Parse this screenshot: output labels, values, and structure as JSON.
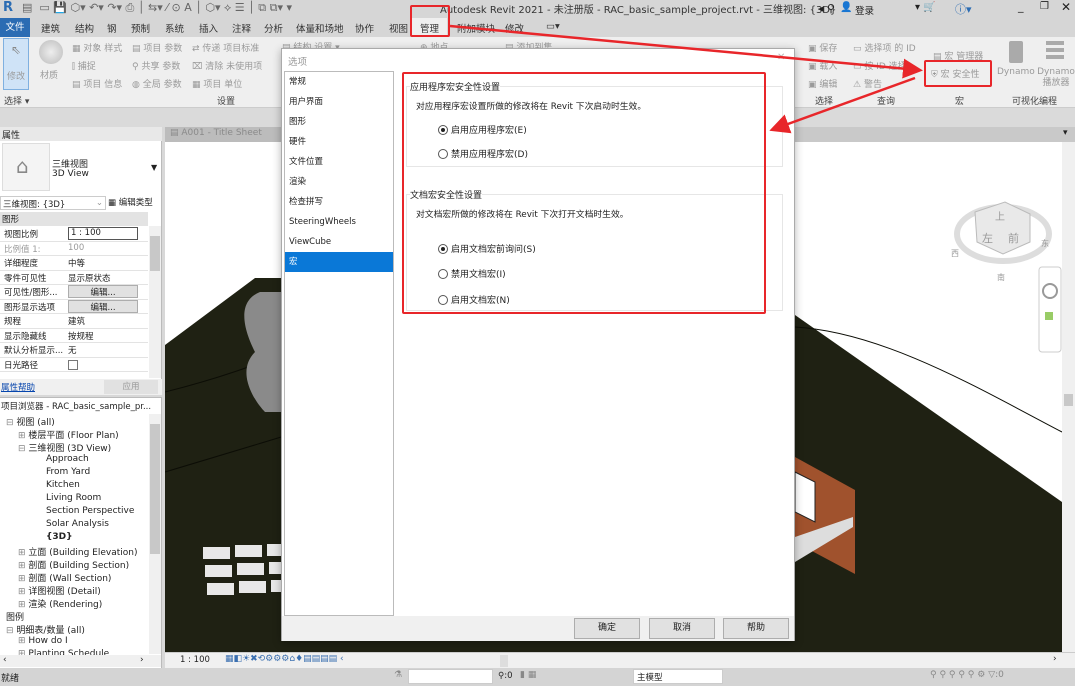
{
  "app": {
    "title": "Autodesk Revit 2021 - 未注册版 - RAC_basic_sample_project.rvt - 三维视图: {3D}",
    "sign_in": "登录"
  },
  "tabs": [
    "文件",
    "建筑",
    "结构",
    "钢",
    "预制",
    "系统",
    "插入",
    "注释",
    "分析",
    "体量和场地",
    "协作",
    "视图",
    "管理",
    "附加模块",
    "修改"
  ],
  "active_tab": "管理",
  "ribbon": {
    "modify": "修改",
    "material": "材质",
    "settings_items": [
      "对象 样式",
      "捕捉",
      "项目 信息",
      "项目 参数",
      "共享 参数",
      "全局 参数",
      "传递 项目标准",
      "清除 未使用项",
      "项目 单位"
    ],
    "structural_settings": "结构 设置",
    "location": "地点",
    "add_to_set": "添加到集",
    "selection_items": [
      "保存",
      "载入",
      "编辑"
    ],
    "inquiry_items": [
      "选择项 的 ID",
      "按 ID 选择",
      "警告"
    ],
    "macro_items": [
      "宏 管理器",
      "宏 安全性"
    ],
    "dynamo": "Dynamo",
    "dynamo_player": "Dynamo 播放器",
    "groups": {
      "select": "选择 ▾",
      "settings": "设置",
      "selection": "选择",
      "inquiry": "查询",
      "macro": "宏",
      "visual": "可视化编程"
    }
  },
  "properties": {
    "header": "属性",
    "type_name": "三维视图",
    "type_sub": "3D View",
    "selector": "三维视图: {3D}",
    "edit_type": "编辑类型",
    "section": "图形",
    "rows": [
      {
        "k": "视图比例",
        "v": "1 : 100"
      },
      {
        "k": "比例值 1:",
        "v": "100"
      },
      {
        "k": "详细程度",
        "v": "中等"
      },
      {
        "k": "零件可见性",
        "v": "显示原状态"
      },
      {
        "k": "可见性/图形...",
        "v": "编辑..."
      },
      {
        "k": "图形显示选项",
        "v": "编辑..."
      },
      {
        "k": "规程",
        "v": "建筑"
      },
      {
        "k": "显示隐藏线",
        "v": "按规程"
      },
      {
        "k": "默认分析显示...",
        "v": "无"
      },
      {
        "k": "日光路径",
        "v": ""
      }
    ],
    "help": "属性帮助",
    "apply": "应用"
  },
  "browser": {
    "title": "项目浏览器 - RAC_basic_sample_pr...",
    "items": [
      {
        "label": "视图 (all)",
        "lvl": 0
      },
      {
        "label": "楼层平面 (Floor Plan)",
        "lvl": 1
      },
      {
        "label": "三维视图 (3D View)",
        "lvl": 1
      },
      {
        "label": "Approach",
        "lvl": 2
      },
      {
        "label": "From Yard",
        "lvl": 2
      },
      {
        "label": "Kitchen",
        "lvl": 2
      },
      {
        "label": "Living Room",
        "lvl": 2
      },
      {
        "label": "Section Perspective",
        "lvl": 2
      },
      {
        "label": "Solar Analysis",
        "lvl": 2
      },
      {
        "label": "{3D}",
        "lvl": 2
      },
      {
        "label": "立面 (Building Elevation)",
        "lvl": 1
      },
      {
        "label": "剖面 (Building Section)",
        "lvl": 1
      },
      {
        "label": "剖面 (Wall Section)",
        "lvl": 1
      },
      {
        "label": "详图视图 (Detail)",
        "lvl": 1
      },
      {
        "label": "渲染 (Rendering)",
        "lvl": 1
      },
      {
        "label": "图例",
        "lvl": 0
      },
      {
        "label": "明细表/数量 (all)",
        "lvl": 0
      },
      {
        "label": "How do I",
        "lvl": 1
      },
      {
        "label": "Planting Schedule",
        "lvl": 1
      }
    ]
  },
  "view_tab": "A001 - Title Sheet",
  "viewcube": {
    "top": "上",
    "left": "左",
    "front": "前",
    "west": "西",
    "east": "东",
    "south": "南"
  },
  "viewbar": {
    "scale": "1 : 100"
  },
  "status": {
    "text": "就绪",
    "model": "主模型",
    "count1": ":0",
    "count2": ":0"
  },
  "dialog": {
    "title": "选项",
    "nav": [
      "常规",
      "用户界面",
      "图形",
      "硬件",
      "文件位置",
      "渲染",
      "检查拼写",
      "SteeringWheels",
      "ViewCube",
      "宏"
    ],
    "selected_nav": "宏",
    "app_group": {
      "title": "应用程序宏安全性设置",
      "desc": "对应用程序宏设置所做的修改将在 Revit 下次启动时生效。",
      "options": [
        {
          "label": "启用应用程序宏(E)",
          "checked": true
        },
        {
          "label": "禁用应用程序宏(D)",
          "checked": false
        }
      ]
    },
    "doc_group": {
      "title": "文档宏安全性设置",
      "desc": "对文档宏所做的修改将在 Revit 下次打开文档时生效。",
      "options": [
        {
          "label": "启用文档宏前询问(S)",
          "checked": true
        },
        {
          "label": "禁用文档宏(I)",
          "checked": false
        },
        {
          "label": "启用文档宏(N)",
          "checked": false
        }
      ]
    },
    "ok": "确定",
    "cancel": "取消",
    "help": "帮助"
  },
  "colors": {
    "accent": "#0a78d7",
    "annotation": "#e8262a",
    "terrain": "#1f2113"
  }
}
